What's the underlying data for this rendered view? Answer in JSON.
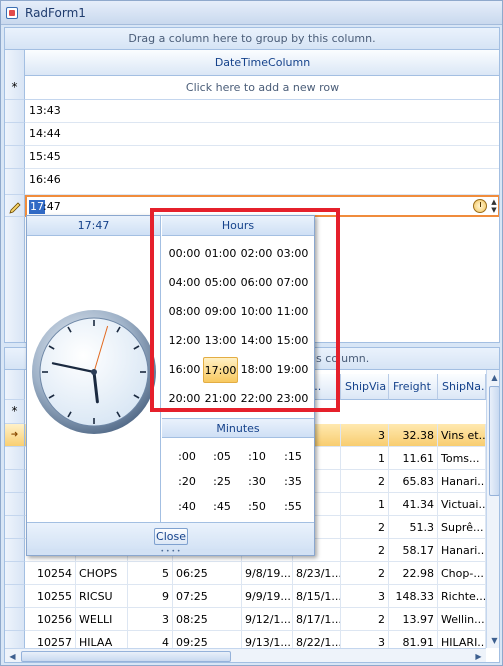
{
  "window": {
    "title": "RadForm1"
  },
  "grid1": {
    "group_panel": "Drag a column here to group by this column.",
    "column_header": "DateTimeColumn",
    "new_row_text": "Click here to add a new row",
    "rows": [
      "13:43",
      "14:44",
      "15:45",
      "16:46"
    ],
    "edit_value_selected": "17",
    "edit_value_rest": ":47"
  },
  "popup": {
    "time_header": "17:47",
    "hours_header": "Hours",
    "hours": [
      "00:00",
      "01:00",
      "02:00",
      "03:00",
      "04:00",
      "05:00",
      "06:00",
      "07:00",
      "08:00",
      "09:00",
      "10:00",
      "11:00",
      "12:00",
      "13:00",
      "14:00",
      "15:00",
      "16:00",
      "17:00",
      "18:00",
      "19:00",
      "20:00",
      "21:00",
      "22:00",
      "23:00"
    ],
    "selected_hour": "17:00",
    "minutes_header": "Minutes",
    "minutes": [
      ":00",
      ":05",
      ":10",
      ":15",
      ":20",
      ":25",
      ":30",
      ":35",
      ":40",
      ":45",
      ":50",
      ":55"
    ],
    "close_label": "Close",
    "clock_time": {
      "hour": 17,
      "minute": 47
    }
  },
  "grid2": {
    "group_panel_tail": "is column.",
    "headers": [
      "pe...",
      "ShipVia",
      "Freight",
      "ShipNa..."
    ],
    "rows": [
      {
        "id": "",
        "cust": "",
        "emp": "",
        "time": "",
        "d1": "/1...",
        "d2": "",
        "via": "3",
        "freight": "32.38",
        "name": "Vins et...",
        "current": true
      },
      {
        "id": "",
        "cust": "",
        "emp": "",
        "time": "",
        "d1": "/1...",
        "d2": "",
        "via": "1",
        "freight": "11.61",
        "name": "Toms..."
      },
      {
        "id": "",
        "cust": "",
        "emp": "",
        "time": "",
        "d1": "/1...",
        "d2": "",
        "via": "2",
        "freight": "65.83",
        "name": "Hanari..."
      },
      {
        "id": "",
        "cust": "",
        "emp": "",
        "time": "",
        "d1": "/1...",
        "d2": "",
        "via": "1",
        "freight": "41.34",
        "name": "Victuai..."
      },
      {
        "id": "",
        "cust": "",
        "emp": "",
        "time": "",
        "d1": "/1...",
        "d2": "",
        "via": "2",
        "freight": "51.3",
        "name": "Suprê..."
      },
      {
        "id": "",
        "cust": "",
        "emp": "",
        "time": "",
        "d1": "/1...",
        "d2": "",
        "via": "2",
        "freight": "58.17",
        "name": "Hanari..."
      },
      {
        "id": "10254",
        "cust": "CHOPS",
        "emp": "5",
        "time": "06:25",
        "d1": "9/8/19...",
        "d2": "8/23/1...",
        "via": "2",
        "freight": "22.98",
        "name": "Chop-..."
      },
      {
        "id": "10255",
        "cust": "RICSU",
        "emp": "9",
        "time": "07:25",
        "d1": "9/9/19...",
        "d2": "8/15/1...",
        "via": "3",
        "freight": "148.33",
        "name": "Richte..."
      },
      {
        "id": "10256",
        "cust": "WELLI",
        "emp": "3",
        "time": "08:25",
        "d1": "9/12/1...",
        "d2": "8/17/1...",
        "via": "2",
        "freight": "13.97",
        "name": "Wellin..."
      },
      {
        "id": "10257",
        "cust": "HILAA",
        "emp": "4",
        "time": "09:25",
        "d1": "9/13/1...",
        "d2": "8/22/1...",
        "via": "3",
        "freight": "81.91",
        "name": "HILARI..."
      }
    ]
  },
  "colors": {
    "accent_orange": "#f08c3c",
    "highlight_red": "#e5202b",
    "selection_blue": "#316ac5",
    "header_text": "#15428b"
  }
}
